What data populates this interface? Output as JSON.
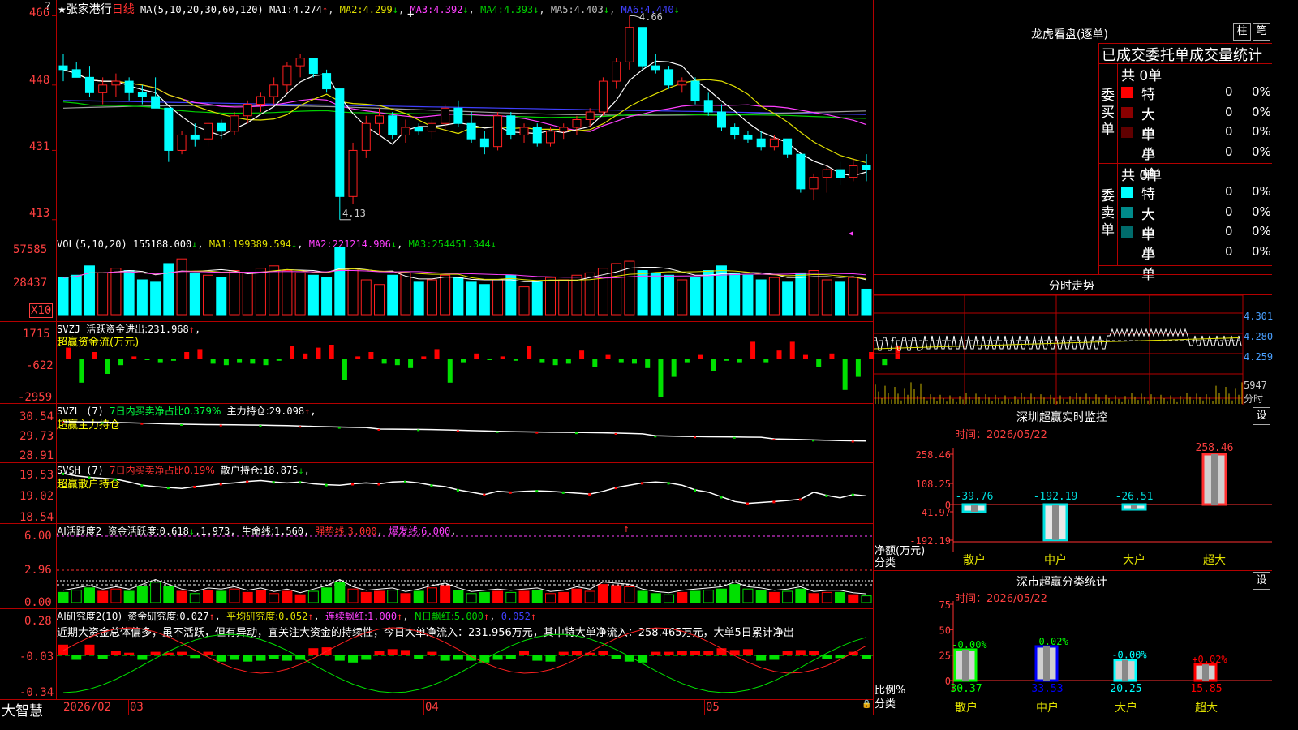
{
  "colors": {
    "up": "#ff2020",
    "down": "#00ffff",
    "ma1": "#ffffff",
    "ma2": "#e0e000",
    "ma3": "#ff40ff",
    "ma4": "#00d000",
    "ma5": "#a0a0a0",
    "ma6": "#4040ff",
    "grid": "#b40000",
    "text": "#ffffff",
    "axis": "#ff4040"
  },
  "window": {
    "app_name": "大智慧"
  },
  "main": {
    "corner_mark": "?",
    "title_star": "★",
    "stock_name": "张家港行",
    "period": "日线",
    "ma_header": "MA(5,10,20,30,60,120)",
    "ma1_label": "MA1:",
    "ma1_val": "4.274",
    "ma1_arrow": "↑",
    "ma2_label": "MA2:",
    "ma2_val": "4.299",
    "ma2_arrow": "↓",
    "ma3_label": "MA3:",
    "ma3_val": "4.392",
    "ma3_arrow": "↓",
    "ma4_label": "MA4:",
    "ma4_val": "4.393",
    "ma4_arrow": "↓",
    "ma5_label": "MA5:",
    "ma5_val": "4.403",
    "ma5_arrow": "↓",
    "ma6_label": "MA6:",
    "ma6_val": "4.440",
    "ma6_arrow": "↓",
    "y_ticks": [
      "466",
      "448",
      "431",
      "413"
    ],
    "high_label": "4.66",
    "low_label": "4.13"
  },
  "vol": {
    "header": "VOL(5,10,20)",
    "value": "155188.000",
    "arrow1": "↓",
    "ma1_label": "MA1:",
    "ma1_val": "199389.594",
    "ma1_arrow": "↓",
    "ma2_label": "MA2:",
    "ma2_val": "221214.906",
    "ma2_arrow": "↓",
    "ma3_label": "MA3:",
    "ma3_val": "254451.344",
    "ma3_arrow": "↓",
    "y_ticks": [
      "57585",
      "28437"
    ],
    "unit": "X10"
  },
  "svzj": {
    "header": "SVZJ",
    "label": "活跃资金进出:",
    "value": "231.968",
    "arrow": "↑",
    "subtitle": "超赢资金流(万元)",
    "y_ticks": [
      "1715",
      "-622",
      "-2959"
    ]
  },
  "svzl": {
    "header": "SVZL (7)",
    "desc": "7日内买卖净占比0.379%",
    "label": "主力持仓:",
    "value": "29.098",
    "arrow": "↑",
    "subtitle": "超赢主力持仓",
    "y_ticks": [
      "30.54",
      "29.73",
      "28.91"
    ]
  },
  "svsh": {
    "header": "SVSH (7)",
    "desc": "7日内买卖净占比0.19%",
    "label": "散户持仓:",
    "value": "18.875",
    "arrow": "↓",
    "subtitle": "超赢散户持仓",
    "y_ticks": [
      "19.53",
      "19.02",
      "18.54"
    ]
  },
  "ai_active": {
    "header": "AI活跃度2",
    "label": "资金活跃度:",
    "value": "0.618",
    "arrow": "↓",
    "v2": "1.973",
    "life_label": "生命线:",
    "life": "1.560",
    "strong_label": "强势线:",
    "strong": "3.000",
    "burst_label": "爆发线:",
    "burst": "6.000",
    "mark": "↑",
    "y_ticks": [
      "6.00",
      "2.96",
      "0.00"
    ]
  },
  "ai_research": {
    "header": "AI研究度2(10)",
    "label": "资金研究度:",
    "value": "0.027",
    "arrow": "↑",
    "avg_label": "平均研究度:",
    "avg": "0.052",
    "avg_arrow": "↑",
    "cont_label": "连续飘红:",
    "cont": "1.000",
    "cont_arrow": "↑",
    "n_label": "N日飘红:",
    "n": "5.000",
    "n_arrow": "↑",
    "last": "0.052",
    "last_arrow": "↑",
    "comment": "近期大资金总体偏多，虽不活跃，但有异动，宜关注大资金的持续性，今日大单净流入：231.956万元，其中特大单净流入：258.465万元，大单5日累计净出",
    "y_ticks": [
      "0.28",
      "-0.03",
      "-0.34"
    ]
  },
  "x_axis": {
    "labels": [
      "2026/02",
      "03",
      "04",
      "05"
    ],
    "lock": "🔒"
  },
  "right": {
    "dragon_title": "龙虎看盘(逐单)",
    "btn_zhu": "柱",
    "btn_bi": "笔",
    "table_title": "已成交委托单成交量统计",
    "buy_side": "委买单",
    "sell_side": "委卖单",
    "buy_total": "共 0单",
    "sell_total": "共 0单",
    "buy_rows": [
      {
        "name": "特大",
        "v": "0",
        "p": "0%",
        "c": "#ff0000"
      },
      {
        "name": "大单",
        "v": "0",
        "p": "0%",
        "c": "#8b0000"
      },
      {
        "name": "中单",
        "v": "0",
        "p": "0%",
        "c": "#600000"
      },
      {
        "name": "小单",
        "v": "0",
        "p": "0%",
        "c": ""
      }
    ],
    "sell_rows": [
      {
        "name": "特大",
        "v": "0",
        "p": "0%",
        "c": "#00ffff"
      },
      {
        "name": "大单",
        "v": "0",
        "p": "0%",
        "c": "#008b8b"
      },
      {
        "name": "中单",
        "v": "0",
        "p": "0%",
        "c": "#006b6b"
      },
      {
        "name": "小单",
        "v": "0",
        "p": "0%",
        "c": ""
      }
    ],
    "intraday_title": "分时走势",
    "intraday_prices": [
      "4.301",
      "4.280",
      "4.259"
    ],
    "intraday_vol": "5947",
    "intraday_unit": "分时",
    "sz_monitor_title": "深圳超赢实时监控",
    "sz_monitor_btn": "设",
    "sz_monitor_time": "时间：2026/05/22",
    "sz_monitor_yticks": [
      "258.46",
      "108.25",
      "0",
      "-41.97",
      "-192.19"
    ],
    "sz_monitor_axis_label": "净额(万元)",
    "sz_monitor_cat_label": "分类",
    "sz_monitor_categories": [
      "散户",
      "中户",
      "大户",
      "超大"
    ],
    "sz_monitor_values": [
      "-39.76",
      "-192.19",
      "-26.51",
      "258.46"
    ],
    "sz_class_title": "深市超赢分类统计",
    "sz_class_btn": "设",
    "sz_class_time": "时间：2026/05/22",
    "sz_class_yticks": [
      "75",
      "50",
      "25",
      "0"
    ],
    "sz_class_axis_label": "比例%",
    "sz_class_cat_label": "分类",
    "sz_class_categories": [
      "散户",
      "中户",
      "大户",
      "超大"
    ],
    "sz_class_values": [
      "30.37",
      "33.53",
      "20.25",
      "15.85"
    ],
    "sz_class_changes": [
      "-0.00%",
      "-0.02%",
      "-0.00%",
      "+0.02%"
    ]
  },
  "chart_data": {
    "type": "candlestick",
    "title": "张家港行 日线",
    "candles": [
      [
        4.53,
        4.56,
        4.49,
        4.52
      ],
      [
        4.52,
        4.54,
        4.5,
        4.5
      ],
      [
        4.5,
        4.53,
        4.45,
        4.46
      ],
      [
        4.46,
        4.5,
        4.43,
        4.48
      ],
      [
        4.48,
        4.51,
        4.45,
        4.49
      ],
      [
        4.49,
        4.5,
        4.44,
        4.46
      ],
      [
        4.46,
        4.48,
        4.43,
        4.45
      ],
      [
        4.45,
        4.5,
        4.42,
        4.42
      ],
      [
        4.42,
        4.42,
        4.28,
        4.31
      ],
      [
        4.31,
        4.36,
        4.3,
        4.35
      ],
      [
        4.35,
        4.38,
        4.32,
        4.34
      ],
      [
        4.34,
        4.39,
        4.32,
        4.38
      ],
      [
        4.38,
        4.39,
        4.34,
        4.36
      ],
      [
        4.36,
        4.41,
        4.35,
        4.4
      ],
      [
        4.4,
        4.44,
        4.38,
        4.43
      ],
      [
        4.43,
        4.46,
        4.41,
        4.45
      ],
      [
        4.45,
        4.5,
        4.43,
        4.48
      ],
      [
        4.48,
        4.54,
        4.46,
        4.53
      ],
      [
        4.53,
        4.56,
        4.5,
        4.55
      ],
      [
        4.55,
        4.55,
        4.5,
        4.51
      ],
      [
        4.51,
        4.52,
        4.46,
        4.47
      ],
      [
        4.47,
        4.47,
        4.13,
        4.19
      ],
      [
        4.19,
        4.33,
        4.17,
        4.31
      ],
      [
        4.31,
        4.4,
        4.29,
        4.38
      ],
      [
        4.38,
        4.42,
        4.35,
        4.4
      ],
      [
        4.4,
        4.41,
        4.34,
        4.35
      ],
      [
        4.35,
        4.39,
        4.33,
        4.37
      ],
      [
        4.37,
        4.38,
        4.35,
        4.36
      ],
      [
        4.36,
        4.39,
        4.34,
        4.38
      ],
      [
        4.38,
        4.43,
        4.36,
        4.42
      ],
      [
        4.42,
        4.44,
        4.37,
        4.38
      ],
      [
        4.38,
        4.41,
        4.33,
        4.34
      ],
      [
        4.34,
        4.36,
        4.3,
        4.32
      ],
      [
        4.32,
        4.41,
        4.31,
        4.4
      ],
      [
        4.4,
        4.41,
        4.34,
        4.35
      ],
      [
        4.35,
        4.38,
        4.33,
        4.37
      ],
      [
        4.37,
        4.38,
        4.32,
        4.33
      ],
      [
        4.33,
        4.37,
        4.32,
        4.36
      ],
      [
        4.36,
        4.38,
        4.34,
        4.37
      ],
      [
        4.37,
        4.4,
        4.35,
        4.39
      ],
      [
        4.39,
        4.42,
        4.37,
        4.41
      ],
      [
        4.41,
        4.5,
        4.4,
        4.49
      ],
      [
        4.49,
        4.55,
        4.47,
        4.54
      ],
      [
        4.54,
        4.66,
        4.52,
        4.63
      ],
      [
        4.63,
        4.63,
        4.52,
        4.53
      ],
      [
        4.53,
        4.56,
        4.51,
        4.52
      ],
      [
        4.52,
        4.53,
        4.47,
        4.48
      ],
      [
        4.48,
        4.5,
        4.46,
        4.49
      ],
      [
        4.49,
        4.5,
        4.43,
        4.44
      ],
      [
        4.44,
        4.46,
        4.4,
        4.41
      ],
      [
        4.41,
        4.43,
        4.36,
        4.37
      ],
      [
        4.37,
        4.38,
        4.34,
        4.35
      ],
      [
        4.35,
        4.36,
        4.33,
        4.34
      ],
      [
        4.34,
        4.36,
        4.31,
        4.32
      ],
      [
        4.32,
        4.35,
        4.31,
        4.34
      ],
      [
        4.34,
        4.34,
        4.29,
        4.3
      ],
      [
        4.3,
        4.3,
        4.2,
        4.21
      ],
      [
        4.21,
        4.25,
        4.18,
        4.24
      ],
      [
        4.24,
        4.27,
        4.2,
        4.26
      ],
      [
        4.26,
        4.28,
        4.22,
        4.24
      ],
      [
        4.24,
        4.29,
        4.23,
        4.27
      ],
      [
        4.27,
        4.3,
        4.23,
        4.26
      ]
    ],
    "volume": [
      32,
      34,
      42,
      36,
      40,
      38,
      30,
      28,
      44,
      48,
      36,
      34,
      32,
      38,
      36,
      40,
      42,
      38,
      36,
      34,
      32,
      58,
      40,
      30,
      26,
      34,
      36,
      28,
      30,
      34,
      32,
      28,
      26,
      30,
      34,
      24,
      28,
      32,
      30,
      34,
      36,
      40,
      44,
      46,
      38,
      36,
      34,
      30,
      32,
      38,
      42,
      36,
      34,
      30,
      32,
      28,
      36,
      38,
      30,
      28,
      32,
      22
    ],
    "svzj": [
      0.8,
      -1.6,
      0.5,
      -1.0,
      -0.4,
      0.2,
      0,
      -0.2,
      -0.1,
      0.5,
      0.7,
      -0.3,
      -0.4,
      -0.2,
      -0.3,
      -0.4,
      -0.1,
      0.9,
      0.4,
      0.8,
      1.0,
      -1.4,
      0.2,
      0.5,
      -0.3,
      -0.4,
      -0.6,
      0.2,
      0.7,
      -1.6,
      -0.2,
      0.4,
      0,
      0.2,
      -0.1,
      0.9,
      -0.2,
      -0.4,
      -0.3,
      0.6,
      -0.5,
      0.3,
      -0.2,
      -0.3,
      -0.6,
      -2.6,
      -1.2,
      -0.2,
      0.3,
      -0.8,
      -0.1,
      -0.2,
      1.2,
      -0.2,
      0.6,
      1.2,
      0.3,
      -0.5,
      0.4,
      -2.1,
      -1.2,
      0.5,
      -0.4,
      0.9
    ]
  }
}
